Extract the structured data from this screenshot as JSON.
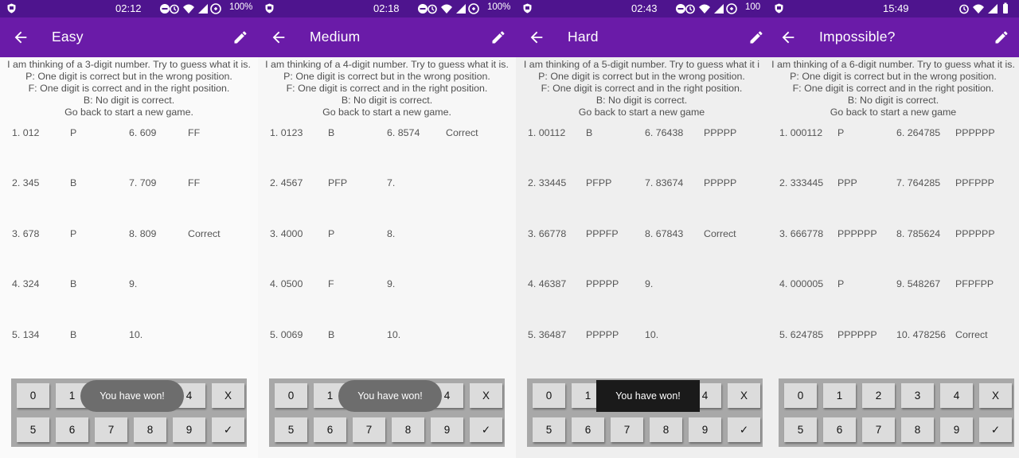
{
  "colors": {
    "statusbar": "#4e148e",
    "toolbar": "#6a1ba8",
    "background": "#fafafa",
    "keypad": "#a8a8a8",
    "key": "#dcdcdc"
  },
  "instructions_common": [
    "P: One digit is correct but in the wrong position.",
    "F: One digit is correct and in the right position.",
    "B: No digit is correct."
  ],
  "keypad": {
    "row1": [
      "0",
      "1",
      "2",
      "3",
      "4",
      "X"
    ],
    "row2": [
      "5",
      "6",
      "7",
      "8",
      "9",
      "✓"
    ]
  },
  "screens": [
    {
      "status": {
        "time": "02:12",
        "battery": "100%"
      },
      "title": "Easy",
      "line1": "I am thinking of a 3-digit number. Try to guess what it is.",
      "line5": "Go back to start a new game.",
      "guesses": [
        {
          "label": "1. 012",
          "result": "P"
        },
        {
          "label": "2. 345",
          "result": "B"
        },
        {
          "label": "3. 678",
          "result": "P"
        },
        {
          "label": "4. 324",
          "result": "B"
        },
        {
          "label": "5. 134",
          "result": "B"
        },
        {
          "label": "6. 609",
          "result": "FF"
        },
        {
          "label": "7. 709",
          "result": "FF"
        },
        {
          "label": "8. 809",
          "result": "Correct"
        },
        {
          "label": "9.",
          "result": ""
        },
        {
          "label": "10.",
          "result": ""
        }
      ],
      "toast": "You have won!"
    },
    {
      "status": {
        "time": "02:18",
        "battery": "100%"
      },
      "title": "Medium",
      "line1": "I am thinking of a 4-digit number. Try to guess what it is.",
      "line5": "Go back to start a new game.",
      "guesses": [
        {
          "label": "1. 0123",
          "result": "B"
        },
        {
          "label": "2. 4567",
          "result": "PFP"
        },
        {
          "label": "3. 4000",
          "result": "P"
        },
        {
          "label": "4. 0500",
          "result": "F"
        },
        {
          "label": "5. 0069",
          "result": "B"
        },
        {
          "label": "6. 8574",
          "result": "Correct"
        },
        {
          "label": "7.",
          "result": ""
        },
        {
          "label": "8.",
          "result": ""
        },
        {
          "label": "9.",
          "result": ""
        },
        {
          "label": "10.",
          "result": ""
        }
      ],
      "toast": "You have won!"
    },
    {
      "status": {
        "time": "02:43",
        "battery": "100"
      },
      "title": "Hard",
      "line1": "I am thinking of a 5-digit number. Try to guess what it i",
      "line5": "Go back to start a new game",
      "guesses": [
        {
          "label": "1. 00112",
          "result": "B"
        },
        {
          "label": "2. 33445",
          "result": "PFPP"
        },
        {
          "label": "3. 66778",
          "result": "PPPFP"
        },
        {
          "label": "4. 46387",
          "result": "PPPPP"
        },
        {
          "label": "5. 36487",
          "result": "PPPPP"
        },
        {
          "label": "6. 76438",
          "result": "PPPPP"
        },
        {
          "label": "7. 83674",
          "result": "PPPPP"
        },
        {
          "label": "8. 67843",
          "result": "Correct"
        },
        {
          "label": "9.",
          "result": ""
        },
        {
          "label": "10.",
          "result": ""
        }
      ],
      "toast": "You have won!"
    },
    {
      "status": {
        "time": "15:49",
        "battery": ""
      },
      "title": "Impossible?",
      "line1": "I am thinking of a 6-digit number. Try to guess what it is.",
      "line5": "Go back to start a new game",
      "guesses": [
        {
          "label": "1. 000112",
          "result": "P"
        },
        {
          "label": "2. 333445",
          "result": "PPP"
        },
        {
          "label": "3. 666778",
          "result": "PPPPPP"
        },
        {
          "label": "4. 000005",
          "result": "P"
        },
        {
          "label": "5. 624785",
          "result": "PPPPPP"
        },
        {
          "label": "6. 264785",
          "result": "PPPPPP"
        },
        {
          "label": "7. 764285",
          "result": "PPFPPP"
        },
        {
          "label": "8. 785624",
          "result": "PPPPPP"
        },
        {
          "label": "9. 548267",
          "result": "PFPFPP"
        },
        {
          "label": "10. 478256",
          "result": "Correct"
        }
      ],
      "toast": ""
    }
  ]
}
